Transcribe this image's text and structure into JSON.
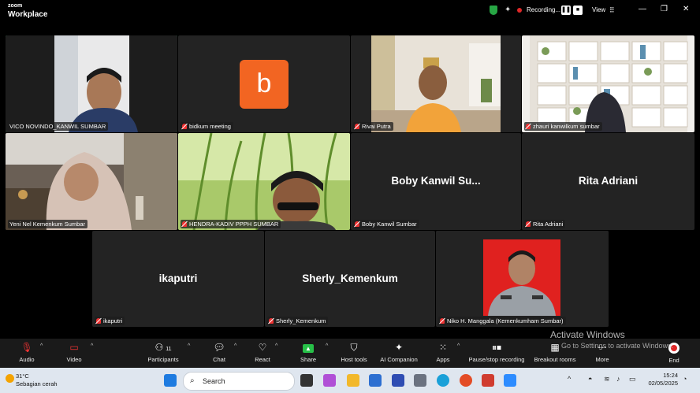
{
  "app": {
    "brand_line1": "zoom",
    "brand_line2": "Workplace"
  },
  "titlebar": {
    "recording_label": "Recording...",
    "view_label": "View"
  },
  "tiles": [
    {
      "name": "VICO NOVINDO_KANWIL SUMBAR",
      "type": "video",
      "muted": false,
      "active": true
    },
    {
      "name": "bidkum meeting",
      "type": "avatar",
      "avatar_letter": "b",
      "avatar_color": "#f26522",
      "muted": true
    },
    {
      "name": "Rivai Putra",
      "type": "video",
      "muted": true
    },
    {
      "name": "zhauri kanwilkum sumbar",
      "type": "video",
      "muted": true
    },
    {
      "name": "Yeni Nel Kemenkum Sumbar",
      "type": "video",
      "muted": false
    },
    {
      "name": "HENDRA-KADIV PPPH SUMBAR",
      "type": "video",
      "muted": true
    },
    {
      "name": "Boby Kanwil Sumbar",
      "display_name": "Boby  Kanwil  Su...",
      "type": "name",
      "muted": true
    },
    {
      "name": "Rita Adriani",
      "display_name": "Rita Adriani",
      "type": "name",
      "muted": true
    },
    {
      "name": "ikaputri",
      "display_name": "ikaputri",
      "type": "name",
      "muted": true
    },
    {
      "name": "Sherly_Kemenkum",
      "display_name": "Sherly_Kemenkum",
      "type": "name",
      "muted": true
    },
    {
      "name": "Niko H. Manggala (Kemenkumham Sumbar)",
      "type": "video",
      "muted": true
    }
  ],
  "toolbar": {
    "audio": "Audio",
    "video": "Video",
    "participants": "Participants",
    "participants_count": "11",
    "chat": "Chat",
    "react": "React",
    "share": "Share",
    "host_tools": "Host tools",
    "ai_companion": "AI Companion",
    "apps": "Apps",
    "pause_stop": "Pause/stop recording",
    "breakout": "Breakout rooms",
    "more": "More",
    "end": "End"
  },
  "watermark": {
    "line1": "Activate Windows",
    "line2": "Go to Settings to activate Windows."
  },
  "taskbar": {
    "temperature": "31°C",
    "weather_text": "Sebagian cerah",
    "search_placeholder": "Search",
    "time": "15:24",
    "date": "02/05/2025"
  },
  "colors": {
    "active_border": "#2dcc6f",
    "recording_dot": "#e02828",
    "end_button": "#e02828",
    "share_icon": "#27c048"
  }
}
